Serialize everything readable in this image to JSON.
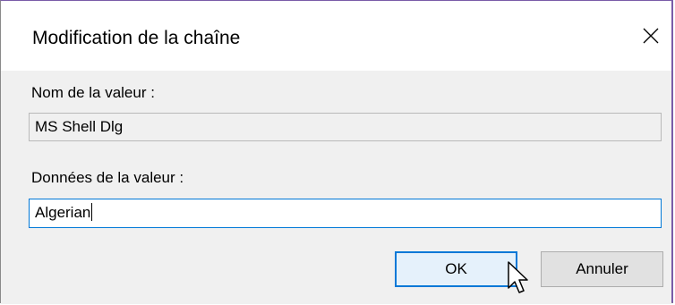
{
  "dialog": {
    "title": "Modification de la chaîne",
    "close_icon": "close-icon"
  },
  "value_name": {
    "label": "Nom de la valeur :",
    "value": "MS Shell Dlg"
  },
  "value_data": {
    "label": "Données de la valeur :",
    "value": "Algerian"
  },
  "buttons": {
    "ok_label": "OK",
    "cancel_label": "Annuler"
  },
  "colors": {
    "accent": "#0078d7",
    "body_bg": "#f0f0f0",
    "ok_bg": "#e5f1fb",
    "cancel_bg": "#e1e1e1",
    "window_border": "#7a5ca8"
  },
  "pointer_icon": "mouse-pointer-icon"
}
